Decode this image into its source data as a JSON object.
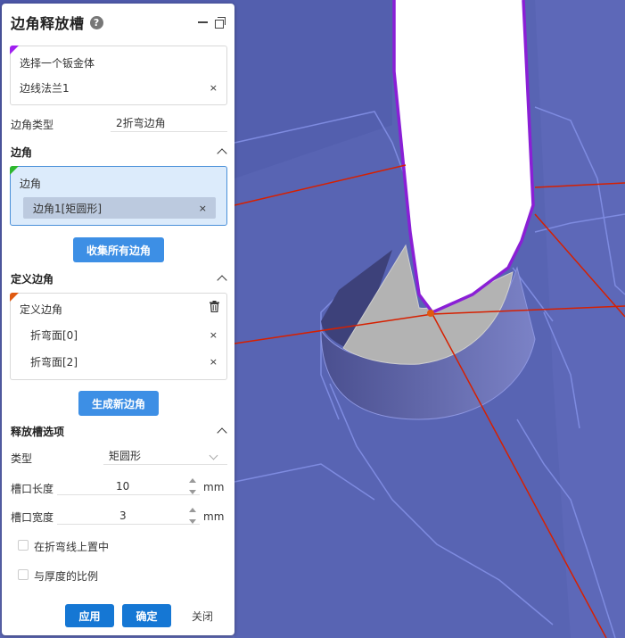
{
  "panel": {
    "title": "边角释放槽",
    "help_glyph": "?",
    "sheet_body": {
      "label": "选择一个钣金体",
      "item": "边线法兰1"
    },
    "corner_type": {
      "label": "边角类型",
      "value": "2折弯边角"
    },
    "corner_section": {
      "header": "边角",
      "box_label": "边角",
      "chip": "边角1[矩圆形]",
      "collect_button": "收集所有边角"
    },
    "define_section": {
      "header": "定义边角",
      "box_label": "定义边角",
      "items": [
        "折弯面[0]",
        "折弯面[2]"
      ],
      "generate_button": "生成新边角"
    },
    "relief_section": {
      "header": "释放槽选项",
      "type_label": "类型",
      "type_value": "矩圆形",
      "slot_length": {
        "label": "槽口长度",
        "value": "10",
        "unit": "mm"
      },
      "slot_width": {
        "label": "槽口宽度",
        "value": "3",
        "unit": "mm"
      },
      "center_on_bend": "在折弯线上置中",
      "proportional": "与厚度的比例"
    },
    "footer": {
      "apply": "应用",
      "ok": "确定",
      "close": "关闭"
    },
    "remove_glyph": "×"
  },
  "colors": {
    "viewport_bg": "#5b65b5",
    "accent": "#3d8fe5",
    "corner_purple": "#a020f0",
    "corner_green": "#2db82d",
    "corner_orange": "#e05a10",
    "edge_red": "#d62000",
    "edge_purple": "#8a1fd6"
  },
  "icons": [
    "help-icon",
    "minimize-icon",
    "restore-icon",
    "remove-icon",
    "trash-icon",
    "chevron-up-icon",
    "chevron-down-icon",
    "stepper-icon",
    "checkbox"
  ]
}
